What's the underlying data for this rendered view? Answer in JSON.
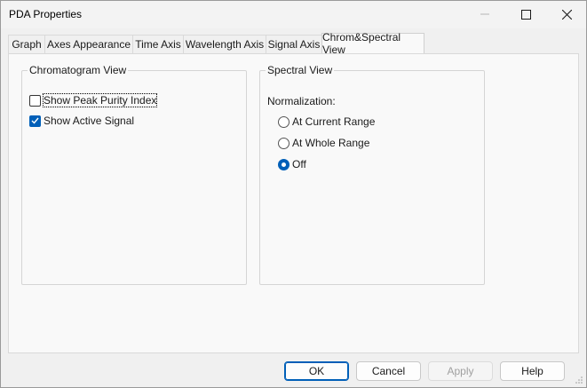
{
  "window": {
    "title": "PDA Properties"
  },
  "tabs": [
    {
      "label": "Graph"
    },
    {
      "label": "Axes Appearance"
    },
    {
      "label": "Time Axis"
    },
    {
      "label": "Wavelength Axis"
    },
    {
      "label": "Signal Axis"
    },
    {
      "label": "Chrom&Spectral View"
    }
  ],
  "chromatogram_view": {
    "title": "Chromatogram View",
    "options": [
      {
        "label": "Show Peak Purity Index",
        "checked": false
      },
      {
        "label": "Show Active Signal",
        "checked": true
      }
    ]
  },
  "spectral_view": {
    "title": "Spectral View",
    "normalization_label": "Normalization:",
    "options": [
      {
        "label": "At Current Range",
        "selected": false
      },
      {
        "label": "At Whole Range",
        "selected": false
      },
      {
        "label": "Off",
        "selected": true
      }
    ]
  },
  "buttons": {
    "ok": "OK",
    "cancel": "Cancel",
    "apply": "Apply",
    "help": "Help"
  },
  "colors": {
    "accent": "#005fb8",
    "window_bg": "#f0f0f0",
    "panel_bg": "#f9f9f9"
  }
}
